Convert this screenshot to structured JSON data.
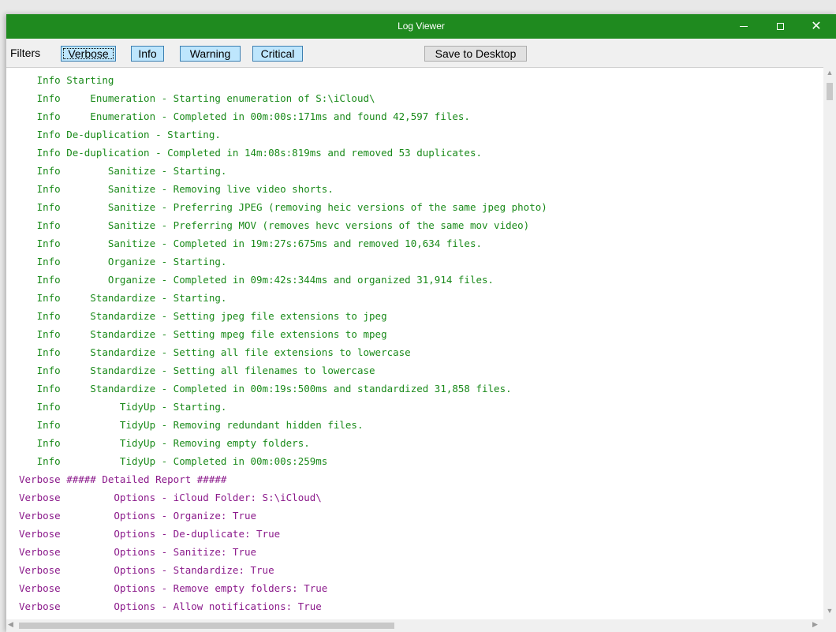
{
  "window": {
    "title": "Log Viewer",
    "controls": {
      "minimize": "—",
      "maximize": "☐",
      "close": "✕"
    }
  },
  "toolbar": {
    "filters_label": "Filters",
    "buttons": {
      "verbose": "Verbose",
      "info": "Info",
      "warning": "Warning",
      "critical": "Critical",
      "save": "Save to Desktop"
    }
  },
  "colors": {
    "titlebar": "#1f8a1f",
    "info_text": "#1a8a1a",
    "verbose_text": "#8b1a8b",
    "filter_button": "#bee6fd"
  },
  "log": [
    {
      "level": "info",
      "text": "   Info Starting"
    },
    {
      "level": "info",
      "text": "   Info     Enumeration - Starting enumeration of S:\\iCloud\\"
    },
    {
      "level": "info",
      "text": "   Info     Enumeration - Completed in 00m:00s:171ms and found 42,597 files."
    },
    {
      "level": "info",
      "text": "   Info De-duplication - Starting."
    },
    {
      "level": "info",
      "text": "   Info De-duplication - Completed in 14m:08s:819ms and removed 53 duplicates."
    },
    {
      "level": "info",
      "text": "   Info        Sanitize - Starting."
    },
    {
      "level": "info",
      "text": "   Info        Sanitize - Removing live video shorts."
    },
    {
      "level": "info",
      "text": "   Info        Sanitize - Preferring JPEG (removing heic versions of the same jpeg photo)"
    },
    {
      "level": "info",
      "text": "   Info        Sanitize - Preferring MOV (removes hevc versions of the same mov video)"
    },
    {
      "level": "info",
      "text": "   Info        Sanitize - Completed in 19m:27s:675ms and removed 10,634 files."
    },
    {
      "level": "info",
      "text": "   Info        Organize - Starting."
    },
    {
      "level": "info",
      "text": "   Info        Organize - Completed in 09m:42s:344ms and organized 31,914 files."
    },
    {
      "level": "info",
      "text": "   Info     Standardize - Starting."
    },
    {
      "level": "info",
      "text": "   Info     Standardize - Setting jpeg file extensions to jpeg"
    },
    {
      "level": "info",
      "text": "   Info     Standardize - Setting mpeg file extensions to mpeg"
    },
    {
      "level": "info",
      "text": "   Info     Standardize - Setting all file extensions to lowercase"
    },
    {
      "level": "info",
      "text": "   Info     Standardize - Setting all filenames to lowercase"
    },
    {
      "level": "info",
      "text": "   Info     Standardize - Completed in 00m:19s:500ms and standardized 31,858 files."
    },
    {
      "level": "info",
      "text": "   Info          TidyUp - Starting."
    },
    {
      "level": "info",
      "text": "   Info          TidyUp - Removing redundant hidden files."
    },
    {
      "level": "info",
      "text": "   Info          TidyUp - Removing empty folders."
    },
    {
      "level": "info",
      "text": "   Info          TidyUp - Completed in 00m:00s:259ms"
    },
    {
      "level": "verbose",
      "text": "Verbose ##### Detailed Report #####"
    },
    {
      "level": "verbose",
      "text": "Verbose         Options - iCloud Folder: S:\\iCloud\\"
    },
    {
      "level": "verbose",
      "text": "Verbose         Options - Organize: True"
    },
    {
      "level": "verbose",
      "text": "Verbose         Options - De-duplicate: True"
    },
    {
      "level": "verbose",
      "text": "Verbose         Options - Sanitize: True"
    },
    {
      "level": "verbose",
      "text": "Verbose         Options - Standardize: True"
    },
    {
      "level": "verbose",
      "text": "Verbose         Options - Remove empty folders: True"
    },
    {
      "level": "verbose",
      "text": "Verbose         Options - Allow notifications: True"
    }
  ]
}
